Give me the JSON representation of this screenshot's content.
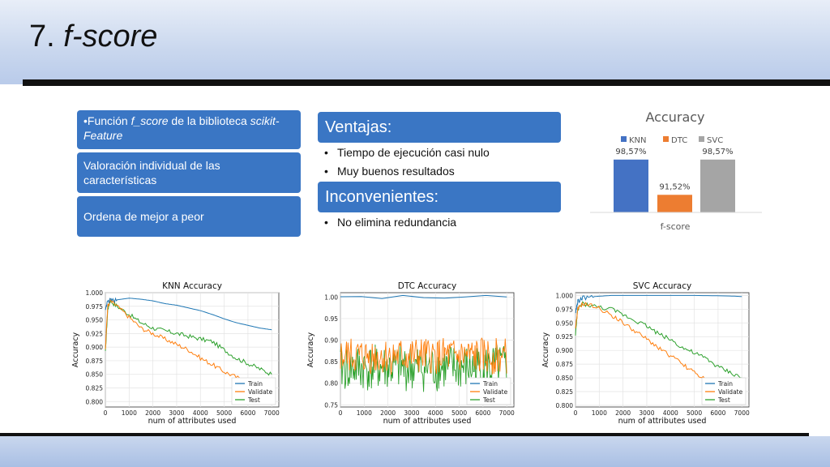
{
  "slide": {
    "title_number": "7.",
    "title_term": "f-score"
  },
  "left_boxes": {
    "box1": {
      "prefix": "•Función ",
      "term": "f_score",
      "middle": " de la biblioteca ",
      "lib": "scikit-Feature"
    },
    "box2": "Valoración individual de las características",
    "box3": "Ordena de mejor a peor"
  },
  "middle": {
    "ventajas_header": "Ventajas:",
    "ventajas_items": [
      "Tiempo de ejecución casi nulo",
      "Muy buenos resultados"
    ],
    "inconvenientes_header": "Inconvenientes:",
    "inconvenientes_items": [
      "No elimina redundancia"
    ]
  },
  "chart_data": [
    {
      "type": "bar",
      "title": "Accuracy",
      "categories": [
        "f-score"
      ],
      "series": [
        {
          "name": "KNN",
          "values": [
            98.57
          ],
          "label": "98,57%",
          "color": "#4472c4"
        },
        {
          "name": "DTC",
          "values": [
            91.52
          ],
          "label": "91,52%",
          "color": "#ed7d31"
        },
        {
          "name": "SVC",
          "values": [
            98.57
          ],
          "label": "98,57%",
          "color": "#a5a5a5"
        }
      ],
      "ylim": [
        88,
        100
      ]
    },
    {
      "type": "line",
      "title": "KNN Accuracy",
      "xlabel": "num of attributes used",
      "ylabel": "Accuracy",
      "xticks": [
        "0",
        "1000",
        "2000",
        "3000",
        "4000",
        "5000",
        "6000",
        "7000"
      ],
      "yticks": [
        "0.800",
        "0.825",
        "0.850",
        "0.875",
        "0.900",
        "0.925",
        "0.950",
        "0.975",
        "1.000"
      ],
      "xlim": [
        0,
        7300
      ],
      "ylim": [
        0.79,
        1.0
      ],
      "legend": "bottom-right",
      "series": [
        {
          "name": "Train",
          "color": "#1f77b4",
          "x": [
            0,
            100,
            200,
            500,
            1000,
            1500,
            2000,
            2500,
            3000,
            3500,
            4000,
            4500,
            5000,
            5500,
            6000,
            6500,
            7000
          ],
          "values": [
            0.97,
            0.985,
            0.986,
            0.987,
            0.99,
            0.988,
            0.985,
            0.98,
            0.977,
            0.972,
            0.967,
            0.96,
            0.952,
            0.945,
            0.94,
            0.935,
            0.932
          ]
        },
        {
          "name": "Validate",
          "color": "#ff7f0e",
          "x": [
            0,
            100,
            200,
            500,
            1000,
            1500,
            2000,
            2500,
            3000,
            3500,
            4000,
            4500,
            5000,
            5500,
            6000,
            6500,
            7000
          ],
          "values": [
            0.9,
            0.975,
            0.985,
            0.975,
            0.955,
            0.935,
            0.925,
            0.915,
            0.905,
            0.895,
            0.88,
            0.868,
            0.855,
            0.845,
            0.835,
            0.825,
            0.815
          ]
        },
        {
          "name": "Test",
          "color": "#2ca02c",
          "x": [
            0,
            100,
            200,
            500,
            1000,
            1500,
            2000,
            2500,
            3000,
            3500,
            4000,
            4500,
            5000,
            5500,
            6000,
            6500,
            7000
          ],
          "values": [
            0.89,
            0.97,
            0.985,
            0.975,
            0.96,
            0.945,
            0.935,
            0.93,
            0.925,
            0.92,
            0.915,
            0.91,
            0.895,
            0.88,
            0.87,
            0.86,
            0.85
          ]
        }
      ]
    },
    {
      "type": "line",
      "title": "DTC Accuracy",
      "xlabel": "num of attributes used",
      "ylabel": "Accuracy",
      "xticks": [
        "0",
        "1000",
        "2000",
        "3000",
        "4000",
        "5000",
        "6000",
        "7000"
      ],
      "yticks": [
        "0.75",
        "0.80",
        "0.85",
        "0.90",
        "0.95",
        "1.00"
      ],
      "xlim": [
        0,
        7300
      ],
      "ylim": [
        0.745,
        1.01
      ],
      "legend": "bottom-right",
      "series": [
        {
          "name": "Train",
          "color": "#1f77b4",
          "x": [
            0,
            7000
          ],
          "values": [
            1.0,
            1.0
          ]
        },
        {
          "name": "Validate",
          "color": "#ff7f0e",
          "band": [
            0.82,
            0.905
          ],
          "x": [
            0,
            7000
          ]
        },
        {
          "name": "Test",
          "color": "#2ca02c",
          "band": [
            0.78,
            0.89
          ],
          "x": [
            0,
            7000
          ]
        }
      ]
    },
    {
      "type": "line",
      "title": "SVC Accuracy",
      "xlabel": "num of attributes used",
      "ylabel": "Accuracy",
      "xticks": [
        "0",
        "1000",
        "2000",
        "3000",
        "4000",
        "5000",
        "6000",
        "7000"
      ],
      "yticks": [
        "0.800",
        "0.825",
        "0.850",
        "0.875",
        "0.900",
        "0.925",
        "0.950",
        "0.975",
        "1.000"
      ],
      "xlim": [
        0,
        7300
      ],
      "ylim": [
        0.797,
        1.005
      ],
      "legend": "bottom-right",
      "series": [
        {
          "name": "Train",
          "color": "#1f77b4",
          "x": [
            0,
            100,
            300,
            800,
            1500,
            3000,
            5000,
            6500,
            7000
          ],
          "values": [
            0.97,
            0.99,
            0.995,
            0.998,
            1.0,
            1.0,
            1.0,
            0.999,
            0.998
          ]
        },
        {
          "name": "Validate",
          "color": "#ff7f0e",
          "x": [
            0,
            100,
            300,
            800,
            1500,
            2000,
            2500,
            3000,
            3500,
            4000,
            4500,
            5000,
            5500,
            6000,
            6500,
            7000
          ],
          "values": [
            0.94,
            0.975,
            0.985,
            0.98,
            0.965,
            0.95,
            0.935,
            0.92,
            0.905,
            0.89,
            0.875,
            0.86,
            0.845,
            0.83,
            0.82,
            0.81
          ]
        },
        {
          "name": "Test",
          "color": "#2ca02c",
          "x": [
            0,
            100,
            300,
            800,
            1500,
            2000,
            2500,
            3000,
            3500,
            4000,
            4500,
            5000,
            5500,
            6000,
            6500,
            7000
          ],
          "values": [
            0.93,
            0.975,
            0.985,
            0.98,
            0.975,
            0.965,
            0.955,
            0.945,
            0.93,
            0.92,
            0.905,
            0.895,
            0.885,
            0.87,
            0.86,
            0.85
          ]
        }
      ]
    }
  ]
}
